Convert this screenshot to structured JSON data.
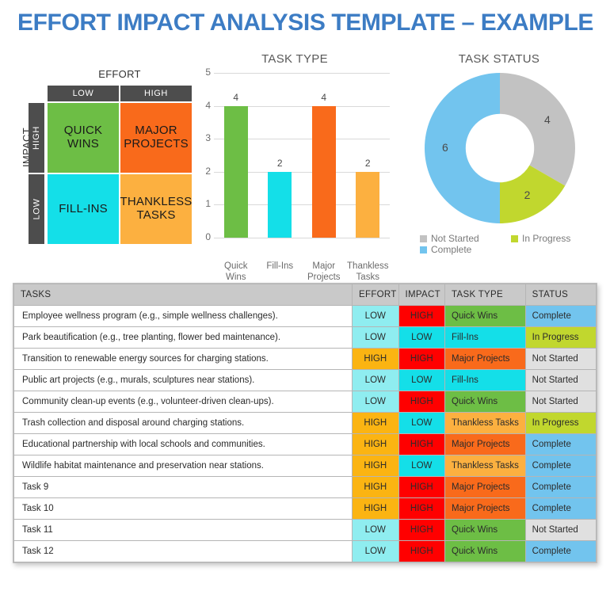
{
  "title": "EFFORT IMPACT ANALYSIS TEMPLATE – EXAMPLE",
  "colors": {
    "title_blue": "#3C7CC4",
    "header_gray": "#4D4D4D",
    "quick_wins_green": "#6DBE45",
    "major_projects_orange": "#F96A1B",
    "fill_ins_cyan": "#14DFE8",
    "thankless_tasks_orange": "#FCB040",
    "effort_low_cyan": "#8FEDF0",
    "effort_high_amber": "#FBB412",
    "impact_low_cyan": "#14DFE8",
    "impact_high_red": "#FF0000",
    "status_not_started_gray": "#E0E0E0",
    "status_in_progress_lime": "#C1D72E",
    "status_complete_blue": "#72C4EE",
    "table_header_gray": "#C9C9C9"
  },
  "matrix": {
    "effort_label": "EFFORT",
    "impact_label": "IMPACT",
    "effort_cols": [
      "LOW",
      "HIGH"
    ],
    "impact_rows": [
      "HIGH",
      "LOW"
    ],
    "quadrants": [
      {
        "label": "QUICK\nWINS",
        "line1": "QUICK",
        "line2": "WINS",
        "color": "#6DBE45"
      },
      {
        "label": "MAJOR\nPROJECTS",
        "line1": "MAJOR",
        "line2": "PROJECTS",
        "color": "#F96A1B"
      },
      {
        "label": "FILL-INS",
        "line1": "FILL-INS",
        "line2": "",
        "color": "#14DFE8"
      },
      {
        "label": "THANKLESS\nTASKS",
        "line1": "THANKLESS",
        "line2": "TASKS",
        "color": "#FCB040"
      }
    ]
  },
  "chart_data": [
    {
      "type": "bar",
      "title": "TASK TYPE",
      "categories": [
        "Quick Wins",
        "Fill-Ins",
        "Major Projects",
        "Thankless Tasks"
      ],
      "category_lines": [
        [
          "Quick",
          "Wins"
        ],
        [
          "Fill-Ins",
          ""
        ],
        [
          "Major",
          "Projects"
        ],
        [
          "Thankless",
          "Tasks"
        ]
      ],
      "values": [
        4,
        2,
        4,
        2
      ],
      "colors": [
        "#6DBE45",
        "#14DFE8",
        "#F96A1B",
        "#FCB040"
      ],
      "xlabel": "",
      "ylabel": "",
      "ylim": [
        0,
        5
      ],
      "yticks": [
        0,
        1,
        2,
        3,
        4,
        5
      ],
      "grid": true,
      "legend": "none"
    },
    {
      "type": "pie",
      "subtype": "donut",
      "title": "TASK STATUS",
      "categories": [
        "Not Started",
        "In Progress",
        "Complete"
      ],
      "values": [
        4,
        2,
        6
      ],
      "colors": [
        "#C2C2C2",
        "#C1D72E",
        "#72C4EE"
      ],
      "total": 12,
      "legend": "bottom"
    }
  ],
  "table": {
    "columns": [
      "TASKS",
      "EFFORT",
      "IMPACT",
      "TASK TYPE",
      "STATUS"
    ],
    "rows": [
      {
        "task": "Employee wellness program (e.g., simple wellness challenges).",
        "effort": "LOW",
        "impact": "HIGH",
        "type": "Quick Wins",
        "status": "Complete"
      },
      {
        "task": "Park beautification (e.g., tree planting, flower bed maintenance).",
        "effort": "LOW",
        "impact": "LOW",
        "type": "Fill-Ins",
        "status": "In Progress"
      },
      {
        "task": "Transition to renewable energy sources for charging stations.",
        "effort": "HIGH",
        "impact": "HIGH",
        "type": "Major Projects",
        "status": "Not Started"
      },
      {
        "task": "Public art projects (e.g., murals, sculptures near stations).",
        "effort": "LOW",
        "impact": "LOW",
        "type": "Fill-Ins",
        "status": "Not Started"
      },
      {
        "task": "Community clean-up events (e.g., volunteer-driven clean-ups).",
        "effort": "LOW",
        "impact": "HIGH",
        "type": "Quick Wins",
        "status": "Not Started"
      },
      {
        "task": "Trash collection and disposal around charging stations.",
        "effort": "HIGH",
        "impact": "LOW",
        "type": "Thankless Tasks",
        "status": "In Progress"
      },
      {
        "task": "Educational partnership with local schools and communities.",
        "effort": "HIGH",
        "impact": "HIGH",
        "type": "Major Projects",
        "status": "Complete"
      },
      {
        "task": "Wildlife habitat maintenance and preservation near stations.",
        "effort": "HIGH",
        "impact": "LOW",
        "type": "Thankless Tasks",
        "status": "Complete"
      },
      {
        "task": "Task 9",
        "effort": "HIGH",
        "impact": "HIGH",
        "type": "Major Projects",
        "status": "Complete"
      },
      {
        "task": "Task 10",
        "effort": "HIGH",
        "impact": "HIGH",
        "type": "Major Projects",
        "status": "Complete"
      },
      {
        "task": "Task 11",
        "effort": "LOW",
        "impact": "HIGH",
        "type": "Quick Wins",
        "status": "Not Started"
      },
      {
        "task": "Task 12",
        "effort": "LOW",
        "impact": "HIGH",
        "type": "Quick Wins",
        "status": "Complete"
      }
    ]
  }
}
